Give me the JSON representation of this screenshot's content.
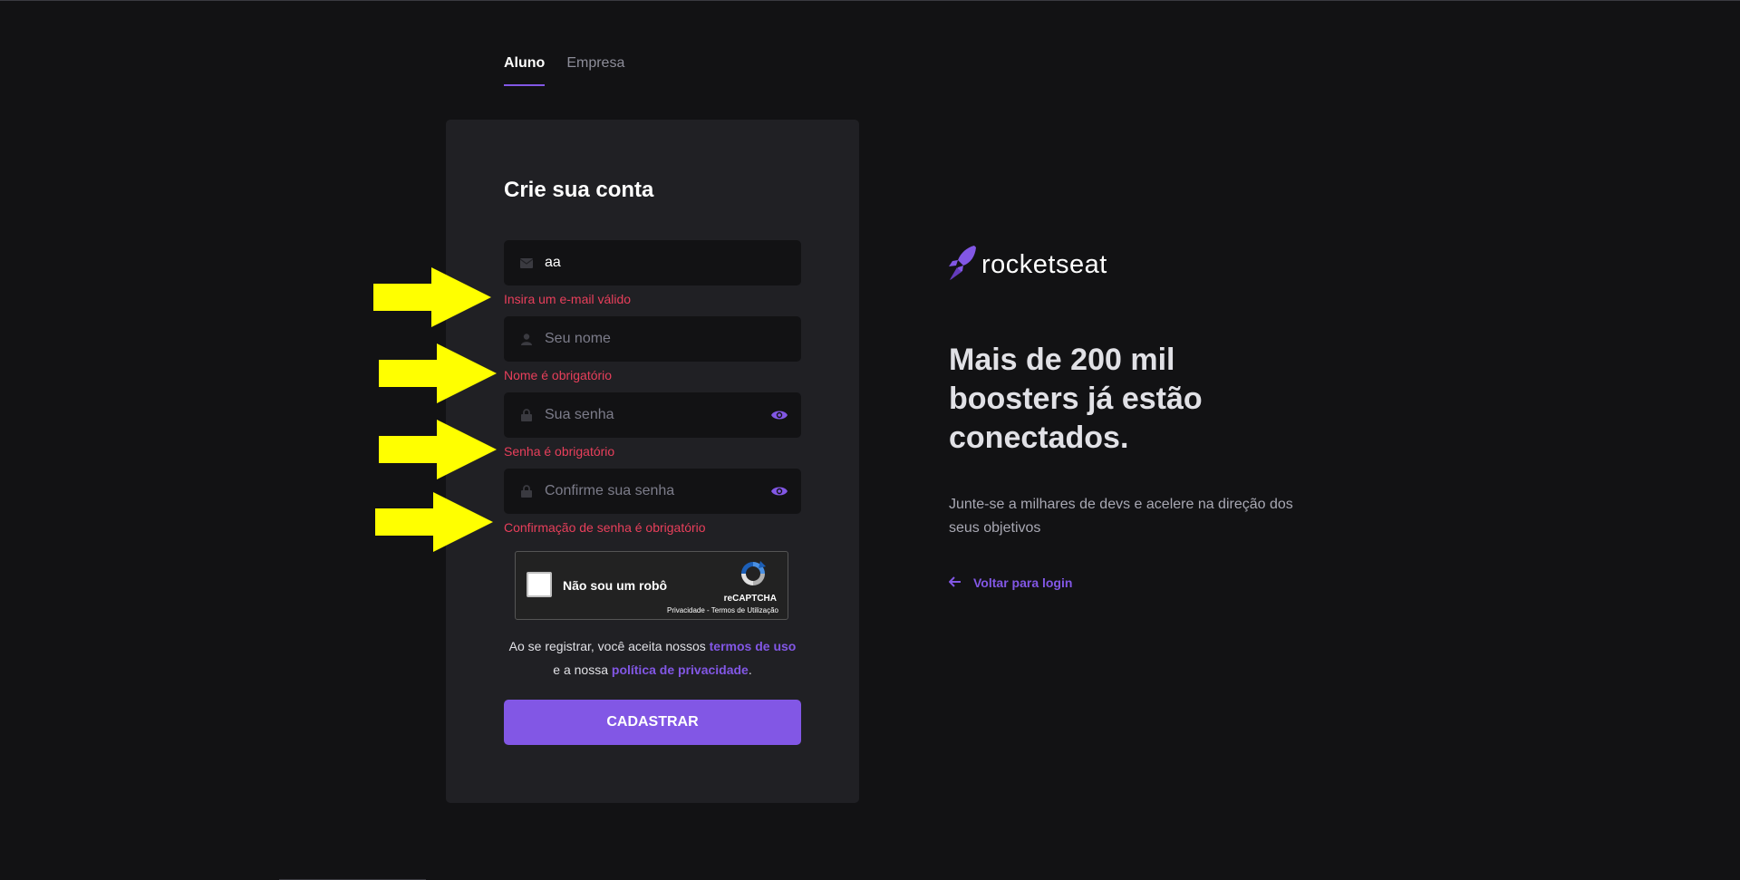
{
  "tabs": [
    {
      "label": "Aluno",
      "active": true
    },
    {
      "label": "Empresa",
      "active": false
    }
  ],
  "form": {
    "title": "Crie sua conta",
    "email": {
      "value": "aa",
      "icon": "envelope-icon",
      "error": "Insira um e-mail válido"
    },
    "name": {
      "placeholder": "Seu nome",
      "icon": "user-icon",
      "error": "Nome é obrigatório"
    },
    "password": {
      "placeholder": "Sua senha",
      "icon": "lock-icon",
      "error": "Senha é obrigatório"
    },
    "confirm_password": {
      "placeholder": "Confirme sua senha",
      "icon": "lock-icon",
      "error": "Confirmação de senha é obrigatório"
    },
    "recaptcha": {
      "label": "Não sou um robô",
      "brand": "reCAPTCHA",
      "links": "Privacidade - Termos de Utilização"
    },
    "terms": {
      "prefix": "Ao se registrar, você aceita nossos ",
      "terms_link": "termos de uso",
      "middle": " e a nossa ",
      "privacy_link": "política de privacidade",
      "suffix": "."
    },
    "submit_label": "CADASTRAR"
  },
  "brand": {
    "name": "rocketseat"
  },
  "headline": "Mais de 200 mil boosters já estão conectados.",
  "subtext": "Junte-se a milhares de devs e acelere na direção dos seus objetivos",
  "back_link": "Voltar para login",
  "colors": {
    "background": "#121214",
    "card": "#202024",
    "input": "#121214",
    "accent": "#8257e5",
    "error": "#e83f5b",
    "annotation_arrow": "#ffff00"
  }
}
